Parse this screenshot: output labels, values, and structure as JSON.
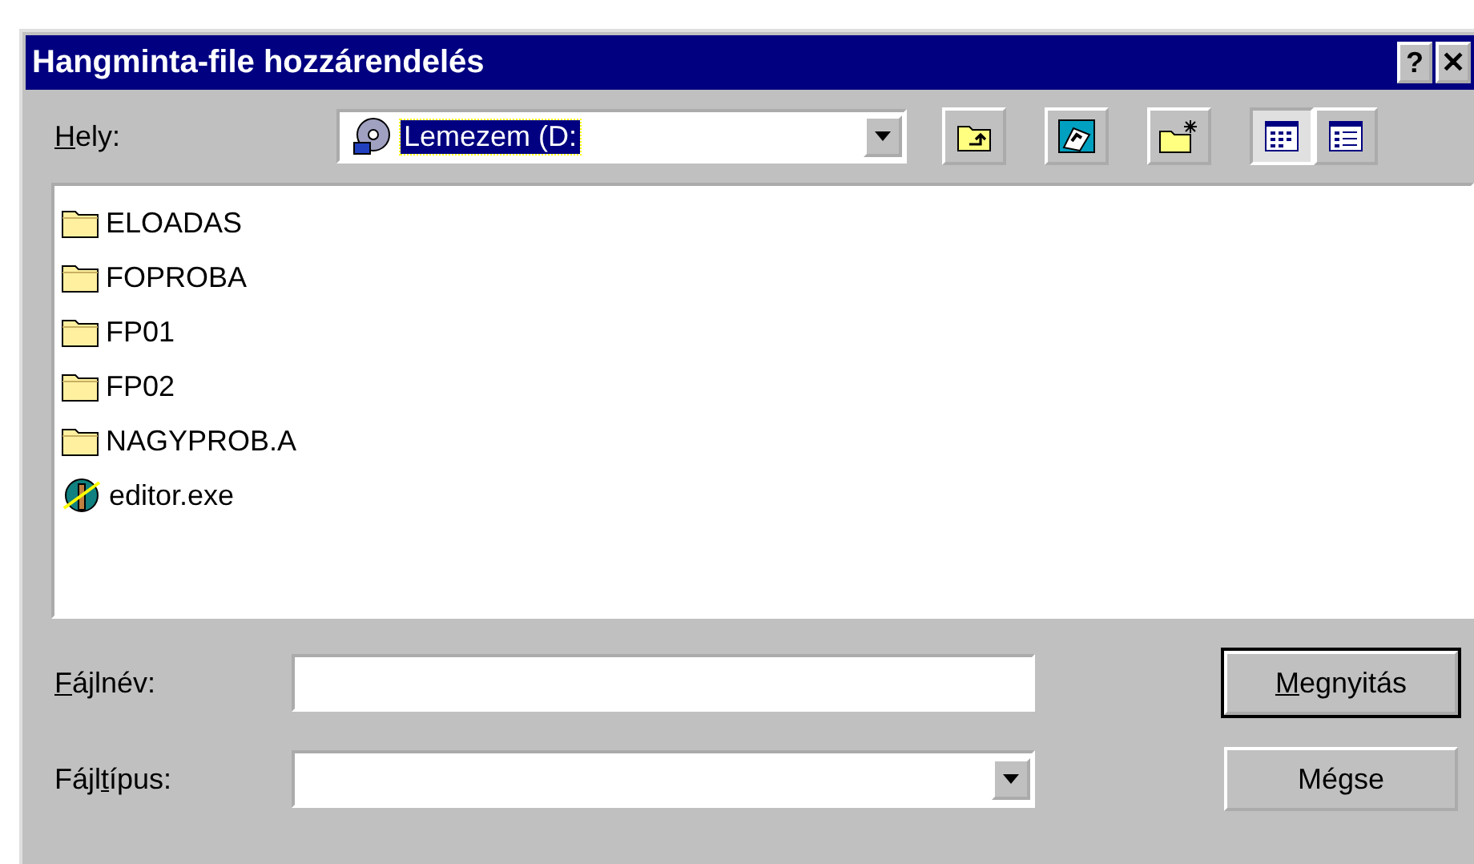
{
  "window": {
    "title": "Hangminta-file hozzárendelés",
    "controls": [
      {
        "glyph": "?"
      },
      {
        "glyph": "✕"
      }
    ]
  },
  "location": {
    "label": [
      {
        "text": "H",
        "underline": true
      },
      {
        "text": "ely:",
        "underline": false
      }
    ],
    "value": "Lemezem (D:",
    "highlighted": true
  },
  "toolbar": [
    {
      "kind": "up-folder"
    },
    {
      "kind": "desktop"
    },
    {
      "kind": "new-folder"
    },
    {
      "kind": "list-view",
      "selected": true
    },
    {
      "kind": "details-view",
      "selected": false
    }
  ],
  "files": [
    {
      "kind": "folder",
      "name": "ELOADAS"
    },
    {
      "kind": "folder",
      "name": "FOPROBA"
    },
    {
      "kind": "folder",
      "name": "FP01"
    },
    {
      "kind": "folder",
      "name": "FP02"
    },
    {
      "kind": "folder",
      "name": "NAGYPROB.A"
    },
    {
      "kind": "exe",
      "name": "editor.exe"
    }
  ],
  "filename": {
    "label": [
      {
        "text": "F",
        "underline": true
      },
      {
        "text": "ájlnév:",
        "underline": false
      }
    ]
  },
  "filetype": {
    "label": [
      {
        "text": "Fájl",
        "underline": false
      },
      {
        "text": "t",
        "underline": true
      },
      {
        "text": "ípus:",
        "underline": false
      }
    ]
  },
  "buttons": [
    {
      "label": [
        {
          "text": "M",
          "underline": true
        },
        {
          "text": "egnyitás",
          "underline": false
        }
      ],
      "default": true
    },
    {
      "label": [
        {
          "text": "Mégse",
          "underline": false
        }
      ],
      "default": false
    }
  ]
}
